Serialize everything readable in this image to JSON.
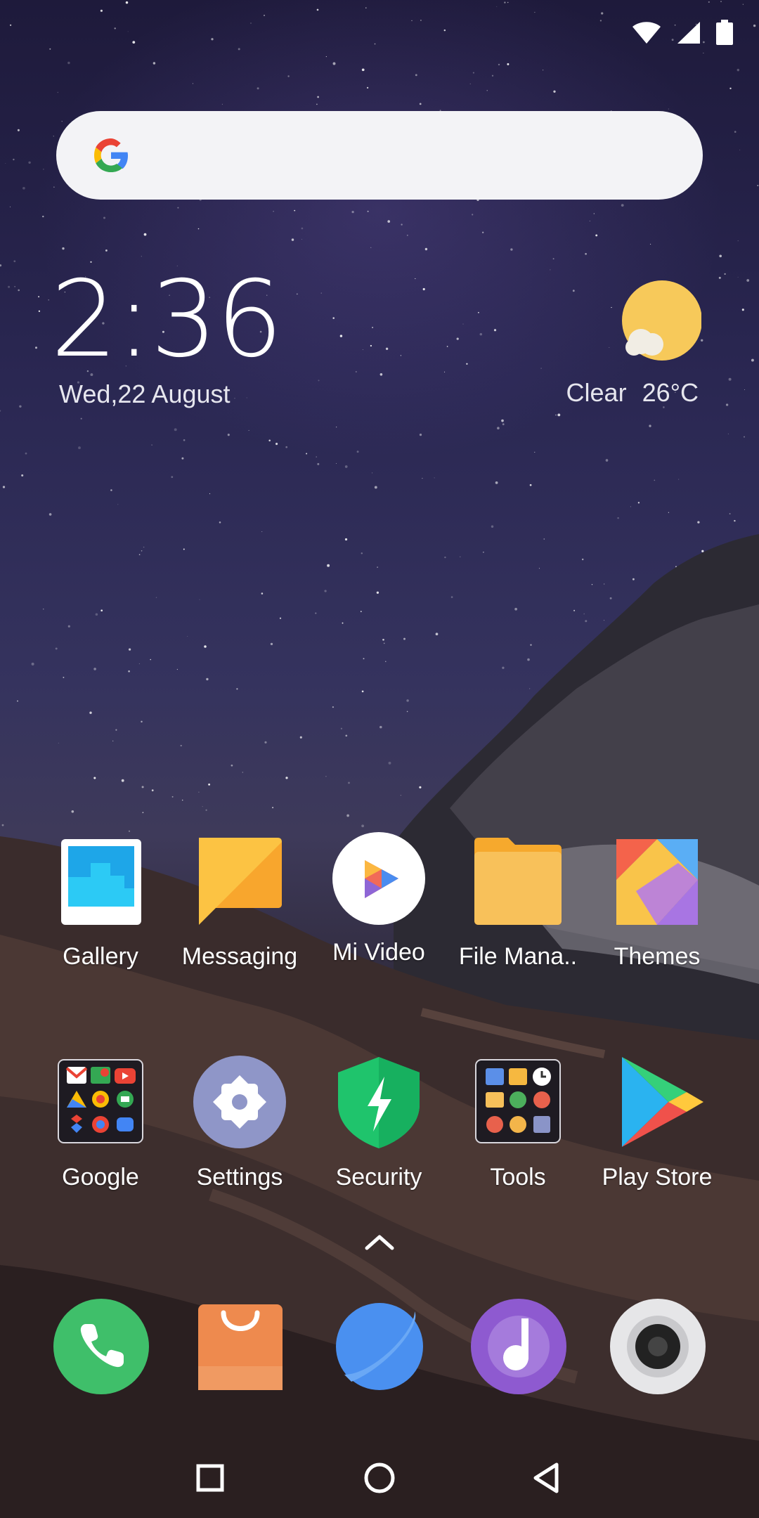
{
  "clock": {
    "time": "2:36",
    "date": "Wed,22 August"
  },
  "weather": {
    "condition": "Clear",
    "temperature": "26°C",
    "icon": "sun-cloud-icon"
  },
  "search": {
    "logo": "google-g-icon"
  },
  "status_bar": {
    "icons": [
      "wifi-icon",
      "cell-signal-icon",
      "battery-icon"
    ]
  },
  "apps_row1": [
    {
      "label": "Gallery",
      "icon": "gallery-icon"
    },
    {
      "label": "Messaging",
      "icon": "messaging-icon"
    },
    {
      "label": "Mi Video",
      "icon": "mi-video-icon"
    },
    {
      "label": "File Mana..",
      "icon": "folder-icon"
    },
    {
      "label": "Themes",
      "icon": "themes-icon"
    }
  ],
  "apps_row2": [
    {
      "label": "Google",
      "icon": "google-folder-icon"
    },
    {
      "label": "Settings",
      "icon": "settings-icon"
    },
    {
      "label": "Security",
      "icon": "security-shield-icon"
    },
    {
      "label": "Tools",
      "icon": "tools-folder-icon"
    },
    {
      "label": "Play Store",
      "icon": "play-store-icon"
    }
  ],
  "dock": [
    "phone-icon",
    "mi-store-icon",
    "browser-icon",
    "music-icon",
    "camera-icon"
  ],
  "nav": [
    "recents-icon",
    "home-icon",
    "back-icon"
  ],
  "colors": {
    "search_bg": "#f3f3f6",
    "phone": "#3fbf6a",
    "store": "#ee8a4e",
    "browser": "#4a90f0",
    "music": "#8e5ad0",
    "security": "#1fc46c"
  }
}
